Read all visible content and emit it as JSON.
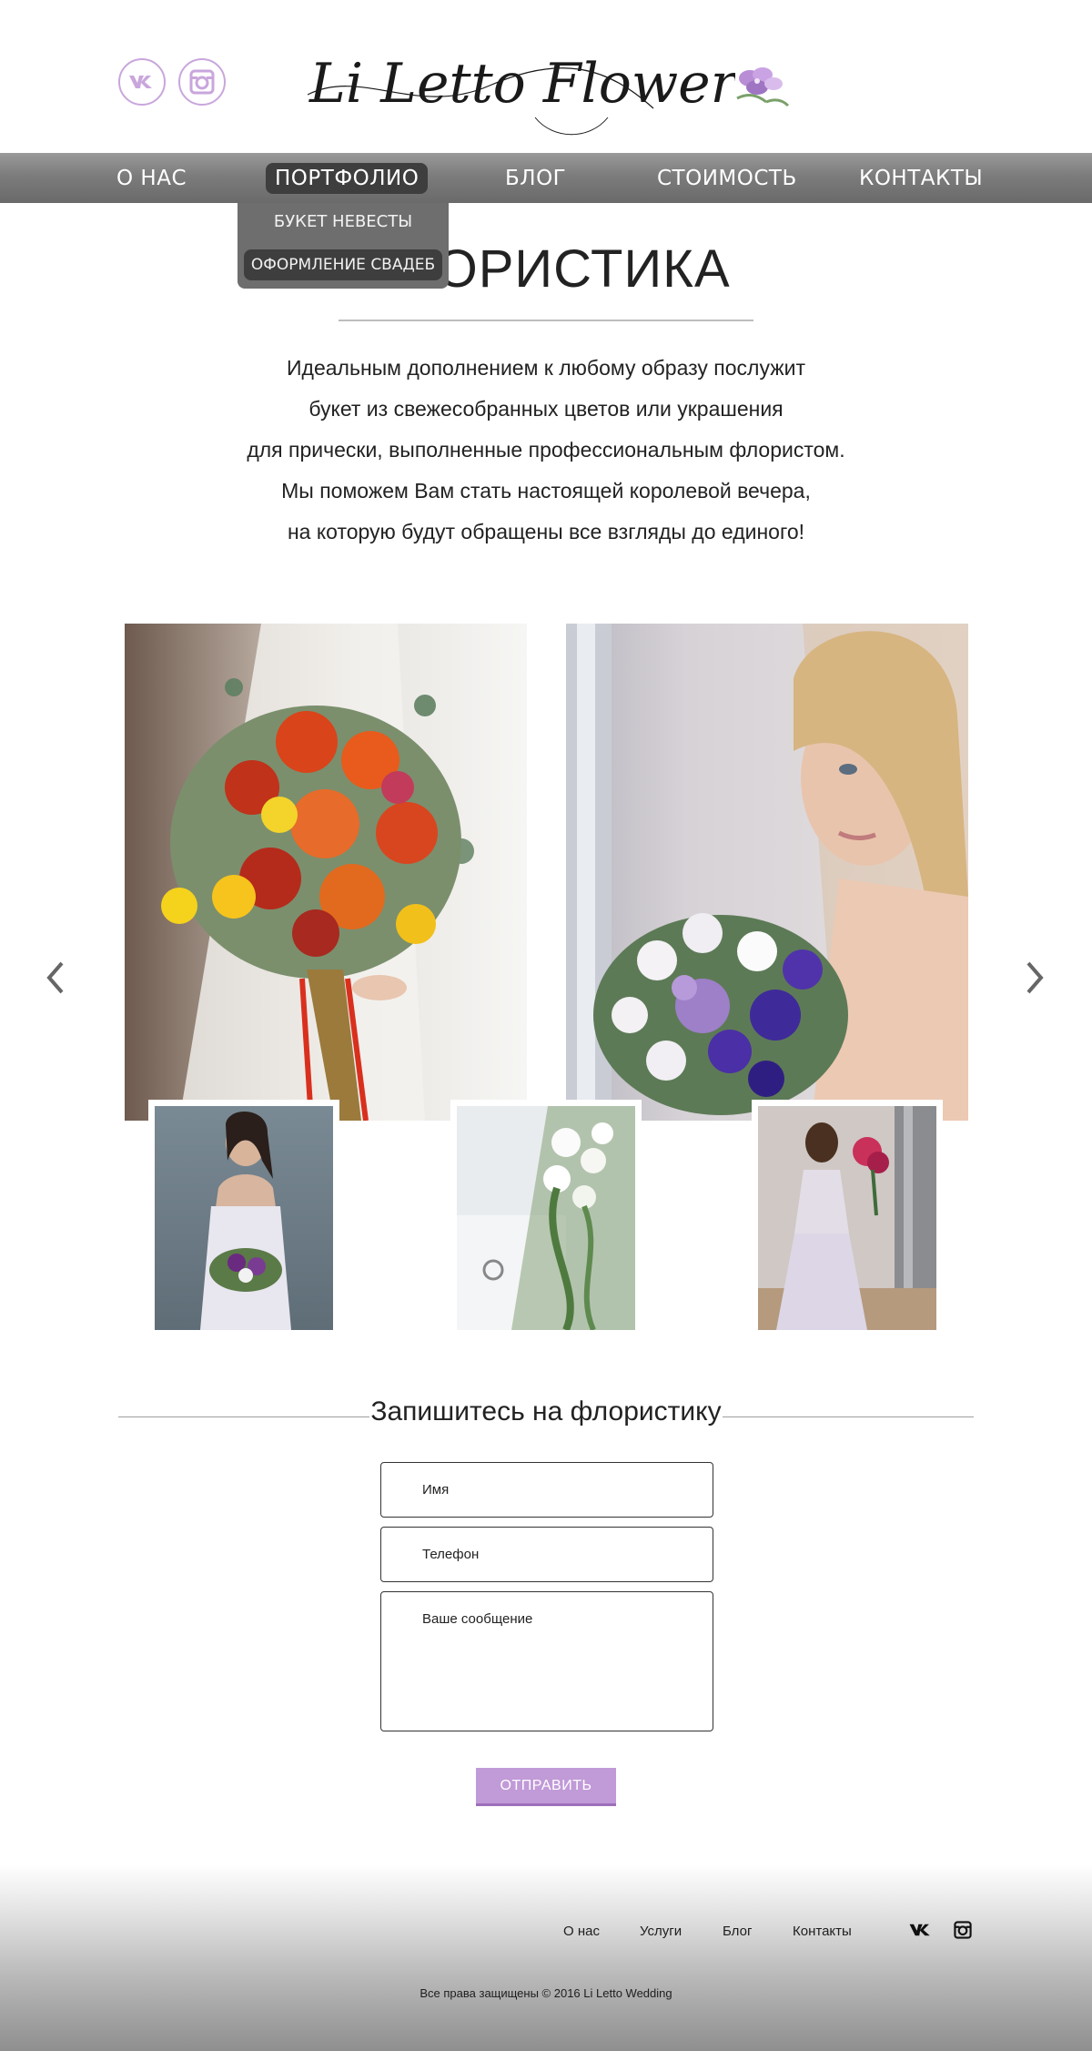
{
  "header": {
    "logo_text": "Li Letto Flower",
    "social": [
      {
        "icon": "vk-icon"
      },
      {
        "icon": "instagram-icon"
      }
    ],
    "accent_color": "#c9a6dc"
  },
  "nav": {
    "items": [
      {
        "label": "О НАС"
      },
      {
        "label": "ПОРТФОЛИО"
      },
      {
        "label": "БЛОГ"
      },
      {
        "label": "СТОИМОСТЬ"
      },
      {
        "label": "КОНТАКТЫ"
      }
    ],
    "active_index": 1,
    "dropdown": [
      {
        "label": "БУКЕТ НЕВЕСТЫ"
      },
      {
        "label": "ОФОРМЛЕНИЕ СВАДЕБ"
      }
    ]
  },
  "page": {
    "title": "ФЛОРИСТИКА",
    "intro": [
      "Идеальным дополнением к любому образу послужит",
      "букет из свежесобранных цветов или украшения",
      "для прически, выполненные профессиональным флористом.",
      "Мы поможем Вам стать настоящей королевой вечера,",
      "на которую будут обращены все взгляды до единого!"
    ]
  },
  "gallery": {
    "prev_icon": "chevron-left-icon",
    "next_icon": "chevron-right-icon"
  },
  "form": {
    "title": "Запишитесь на флористику",
    "name_placeholder": "Имя",
    "phone_placeholder": "Телефон",
    "message_placeholder": "Ваше сообщение",
    "submit_label": "ОТПРАВИТЬ",
    "button_color": "#c19ad8"
  },
  "footer": {
    "links": [
      {
        "label": "О нас"
      },
      {
        "label": "Услуги"
      },
      {
        "label": "Блог"
      },
      {
        "label": "Контакты"
      }
    ],
    "copyright": "Все права защищены © 2016 Li Letto Wedding"
  }
}
